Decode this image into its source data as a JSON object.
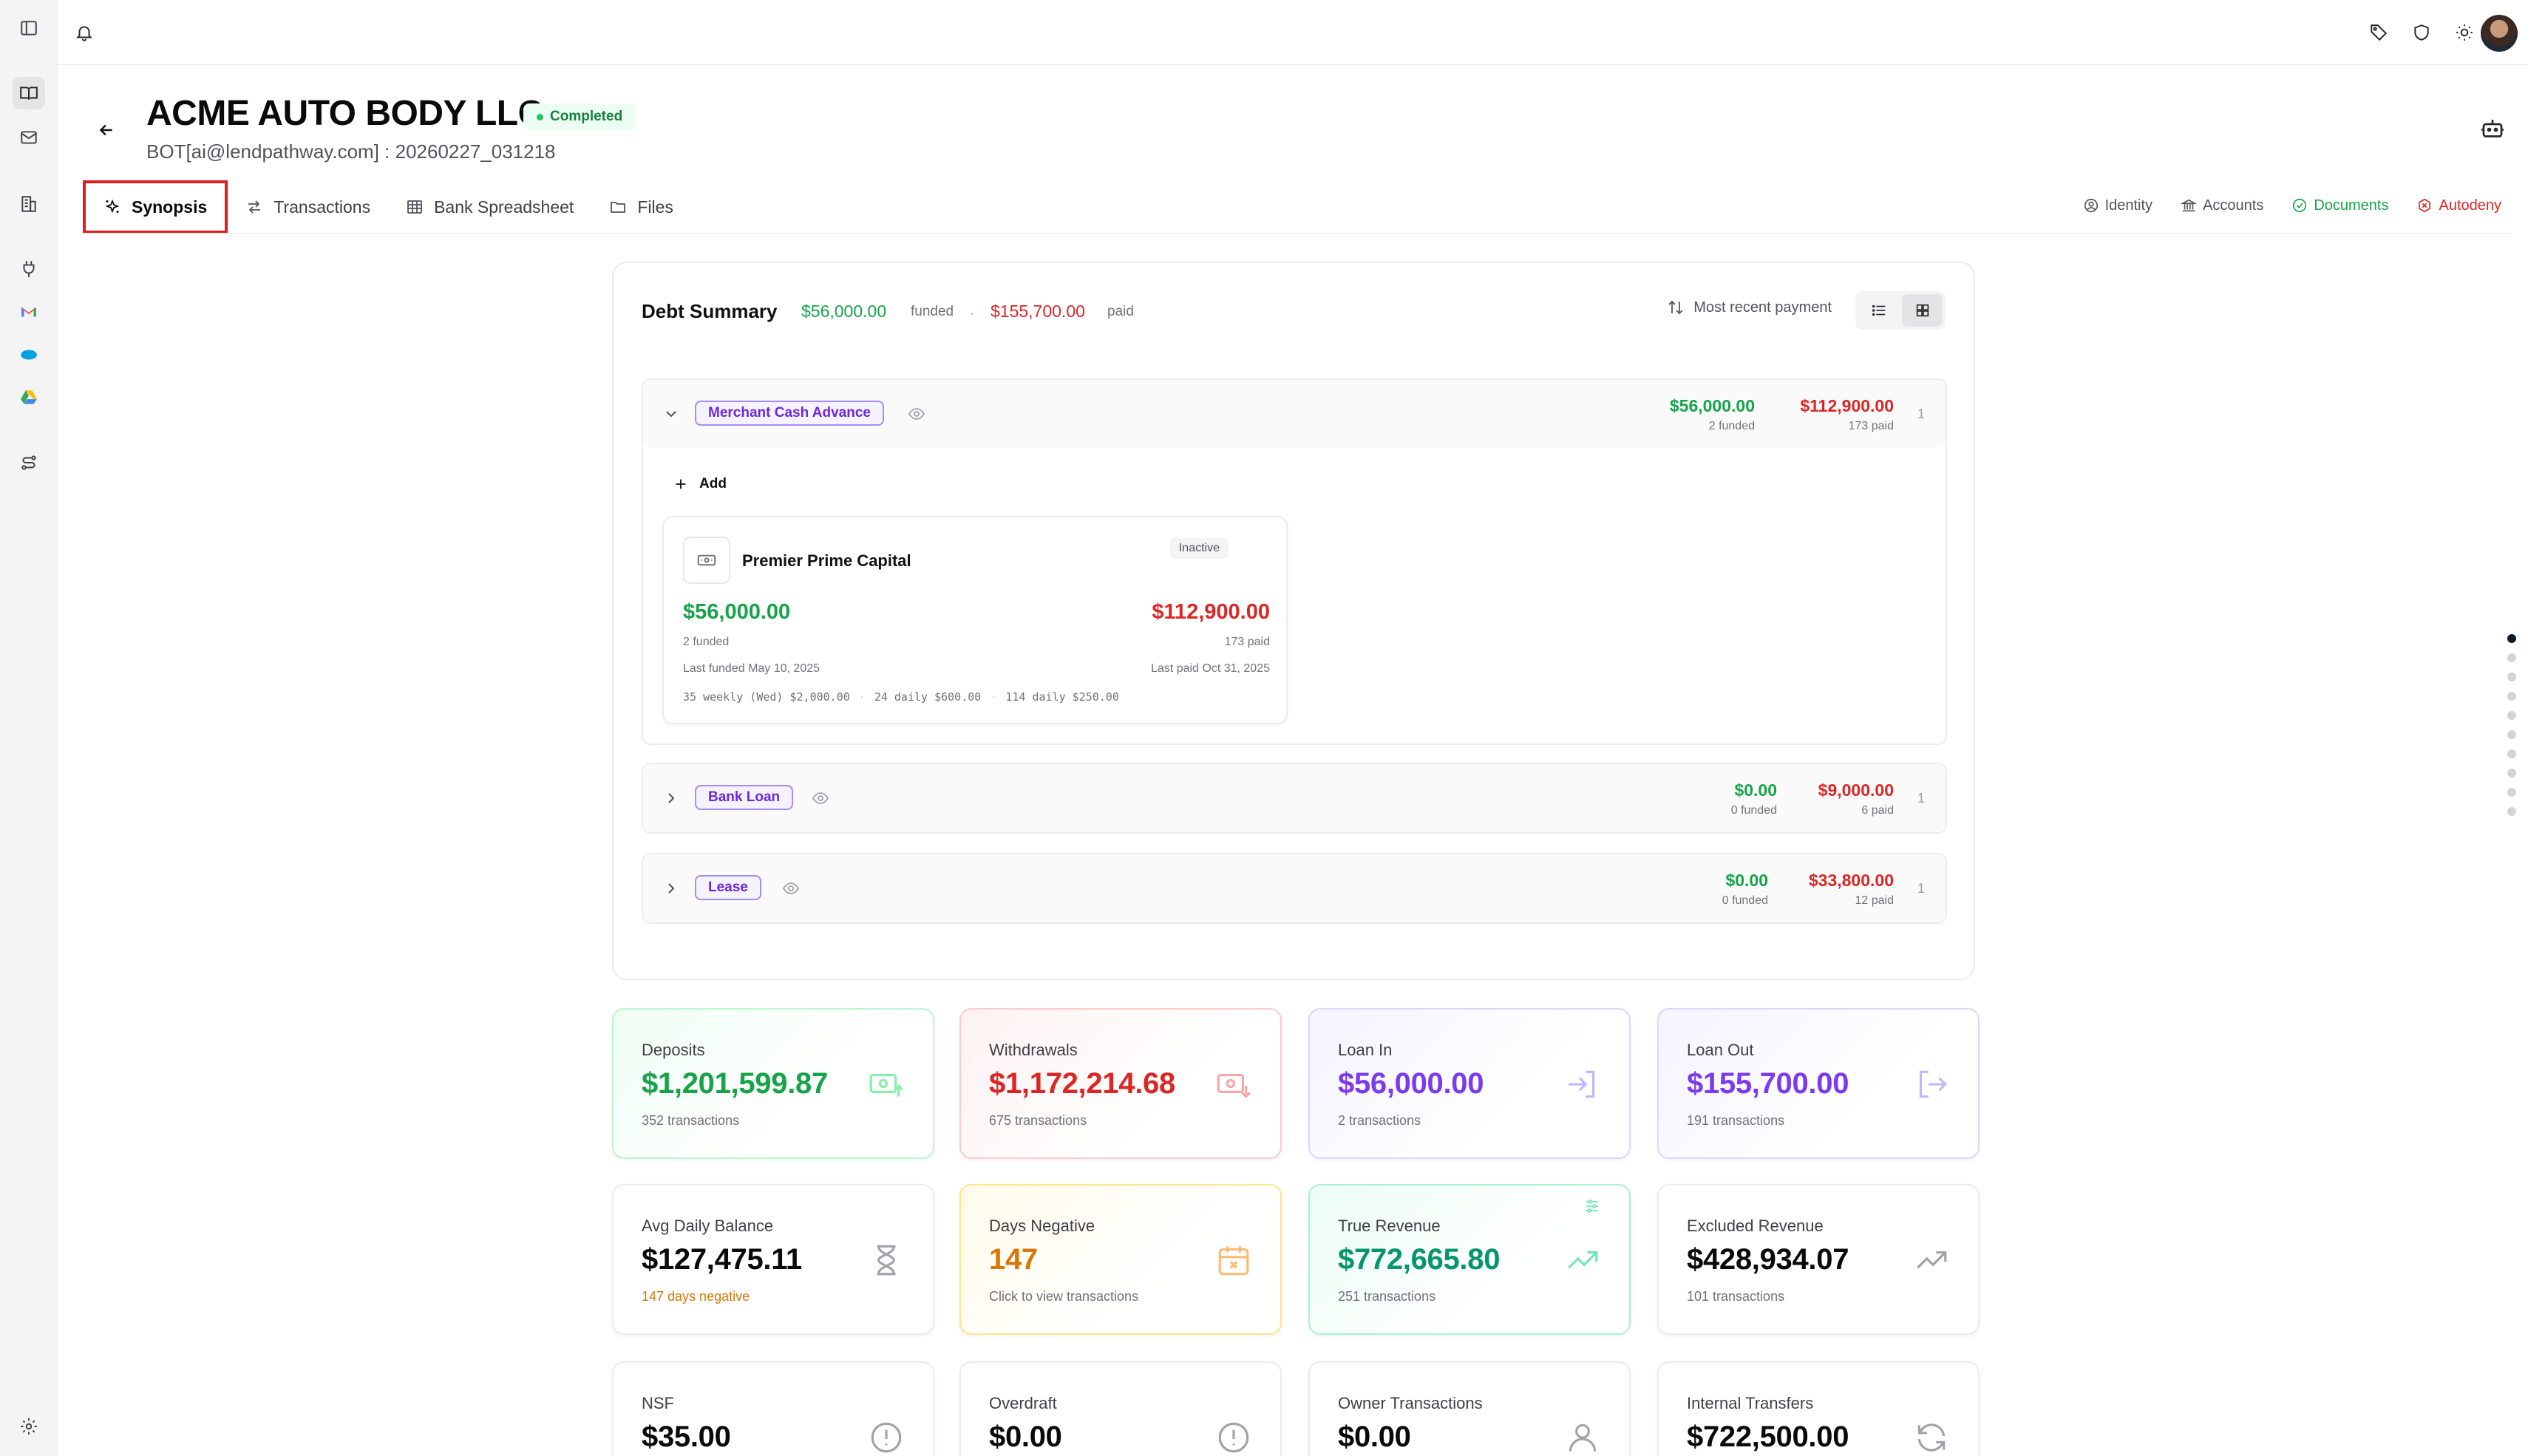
{
  "company": {
    "name": "ACME AUTO BODY LLC",
    "status": "Completed",
    "subtitle": "BOT[ai@lendpathway.com] : 20260227_031218"
  },
  "tabs": [
    {
      "label": "Synopsis",
      "icon": "sparkles-icon",
      "active": true
    },
    {
      "label": "Transactions",
      "icon": "arrows-exchange-icon"
    },
    {
      "label": "Bank Spreadsheet",
      "icon": "table-icon"
    },
    {
      "label": "Files",
      "icon": "folder-icon"
    }
  ],
  "right_tabs": [
    {
      "label": "Identity",
      "icon": "user-circle-icon"
    },
    {
      "label": "Accounts",
      "icon": "bank-icon"
    },
    {
      "label": "Documents",
      "icon": "check-circle-icon",
      "color": "#16a34a"
    },
    {
      "label": "Autodeny",
      "icon": "x-circle-icon",
      "color": "#dc2626"
    }
  ],
  "debt_summary": {
    "title": "Debt Summary",
    "funded_value": "$56,000.00",
    "funded_label": "funded",
    "separator": "·",
    "paid_value": "$155,700.00",
    "paid_label": "paid",
    "sort_label": "Most recent payment",
    "categories": [
      {
        "label": "Merchant Cash Advance",
        "funded": "$56,000.00",
        "funded_sub": "2 funded",
        "paid": "$112,900.00",
        "paid_sub": "173 paid",
        "count": "1",
        "expanded": true
      },
      {
        "label": "Bank Loan",
        "funded": "$0.00",
        "funded_sub": "0 funded",
        "paid": "$9,000.00",
        "paid_sub": "6 paid",
        "count": "1",
        "expanded": false
      },
      {
        "label": "Lease",
        "funded": "$0.00",
        "funded_sub": "0 funded",
        "paid": "$33,800.00",
        "paid_sub": "12 paid",
        "count": "1",
        "expanded": false
      }
    ],
    "add_label": "Add",
    "lender": {
      "name": "Premier Prime Capital",
      "status": "Inactive",
      "funded": "$56,000.00",
      "funded_sub": "2 funded",
      "paid": "$112,900.00",
      "paid_sub": "173 paid",
      "last_funded": "Last funded May 10, 2025",
      "last_paid": "Last paid Oct 31, 2025",
      "schedule": [
        "35 weekly (Wed) $2,000.00",
        "24 daily $600.00",
        "114 daily $250.00"
      ],
      "schedule_sep": "·"
    }
  },
  "metrics": [
    {
      "label": "Deposits",
      "value": "$1,201,599.87",
      "sub": "352 transactions",
      "icon": "cash-in-icon",
      "color": "#16a34a"
    },
    {
      "label": "Withdrawals",
      "value": "$1,172,214.68",
      "sub": "675 transactions",
      "icon": "cash-out-icon",
      "color": "#dc2626"
    },
    {
      "label": "Loan In",
      "value": "$56,000.00",
      "sub": "2 transactions",
      "icon": "login-icon",
      "color": "#7c3aed"
    },
    {
      "label": "Loan Out",
      "value": "$155,700.00",
      "sub": "191 transactions",
      "icon": "logout-icon",
      "color": "#7c3aed"
    },
    {
      "label": "Avg Daily Balance",
      "value": "$127,475.11",
      "sub": "147 days negative",
      "icon": "hourglass-icon"
    },
    {
      "label": "Days Negative",
      "value": "147",
      "sub": "Click to view transactions",
      "icon": "calendar-x-icon",
      "color": "#d97706"
    },
    {
      "label": "True Revenue",
      "value": "$772,665.80",
      "sub": "251 transactions",
      "icon": "trending-up-icon",
      "color": "#059669"
    },
    {
      "label": "Excluded Revenue",
      "value": "$428,934.07",
      "sub": "101 transactions",
      "icon": "trending-up-icon"
    },
    {
      "label": "NSF",
      "value": "$35.00",
      "sub": "",
      "icon": "alert-circle-icon"
    },
    {
      "label": "Overdraft",
      "value": "$0.00",
      "sub": "",
      "icon": "alert-circle-icon"
    },
    {
      "label": "Owner Transactions",
      "value": "$0.00",
      "sub": "",
      "icon": "user-icon"
    },
    {
      "label": "Internal Transfers",
      "value": "$722,500.00",
      "sub": "",
      "icon": "refresh-icon"
    }
  ]
}
